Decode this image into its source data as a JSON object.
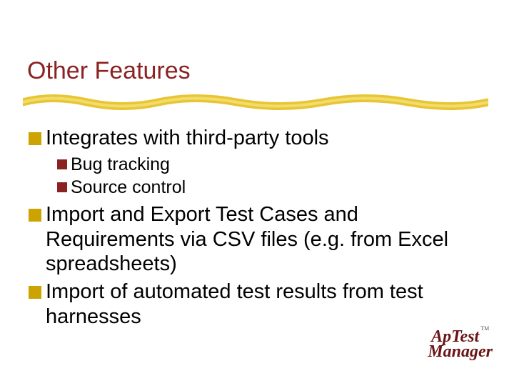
{
  "slide": {
    "title": "Other Features",
    "bullets": {
      "b1": "Integrates with third-party tools",
      "b1_1": "Bug tracking",
      "b1_2": "Source control",
      "b2": "Import and Export Test Cases and Requirements via CSV files (e.g. from Excel spreadsheets)",
      "b3": "Import of automated test results from test harnesses"
    }
  },
  "logo": {
    "line1": "ApTest",
    "line2": "Manager",
    "tm": "TM"
  }
}
